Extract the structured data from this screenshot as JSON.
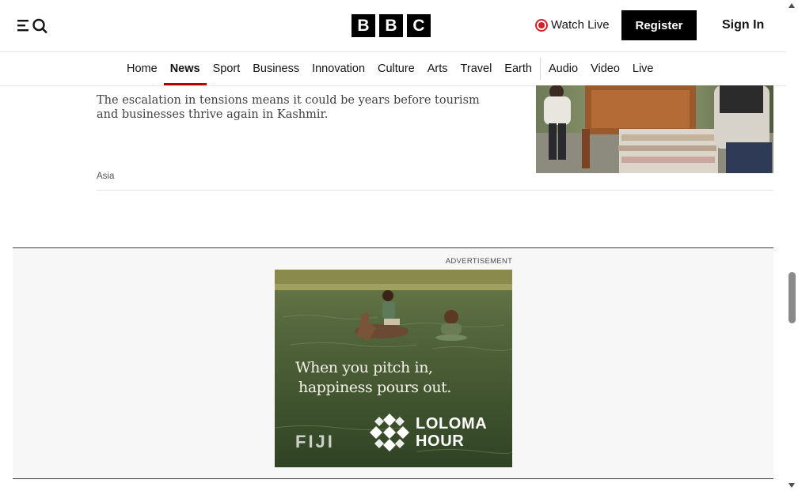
{
  "header": {
    "logo_letters": [
      "B",
      "B",
      "C"
    ],
    "watch_live_label": "Watch Live",
    "register_label": "Register",
    "signin_label": "Sign In",
    "icons": [
      "menu-icon",
      "search-icon",
      "live-icon"
    ]
  },
  "nav": {
    "items": [
      {
        "label": "Home"
      },
      {
        "label": "News"
      },
      {
        "label": "Sport"
      },
      {
        "label": "Business"
      },
      {
        "label": "Innovation"
      },
      {
        "label": "Culture"
      },
      {
        "label": "Arts"
      },
      {
        "label": "Travel"
      },
      {
        "label": "Earth"
      },
      {
        "label": "Audio"
      },
      {
        "label": "Video"
      },
      {
        "label": "Live"
      }
    ],
    "active": "News",
    "active_color": "#b80000"
  },
  "article": {
    "summary": "The escalation in tensions means it could be years before tourism and businesses thrive again in Kashmir.",
    "tag": "Asia"
  },
  "ad": {
    "label": "ADVERTISEMENT",
    "headline_line1": "When you pitch in,",
    "headline_line2": "happiness pours out.",
    "brand_mark": "FIJI",
    "brand_line1": "LOLOMA",
    "brand_line2": "HOUR"
  },
  "colors": {
    "brand_black": "#000000",
    "live_red": "#d61f26",
    "ad_background": "#f7f7f7"
  }
}
